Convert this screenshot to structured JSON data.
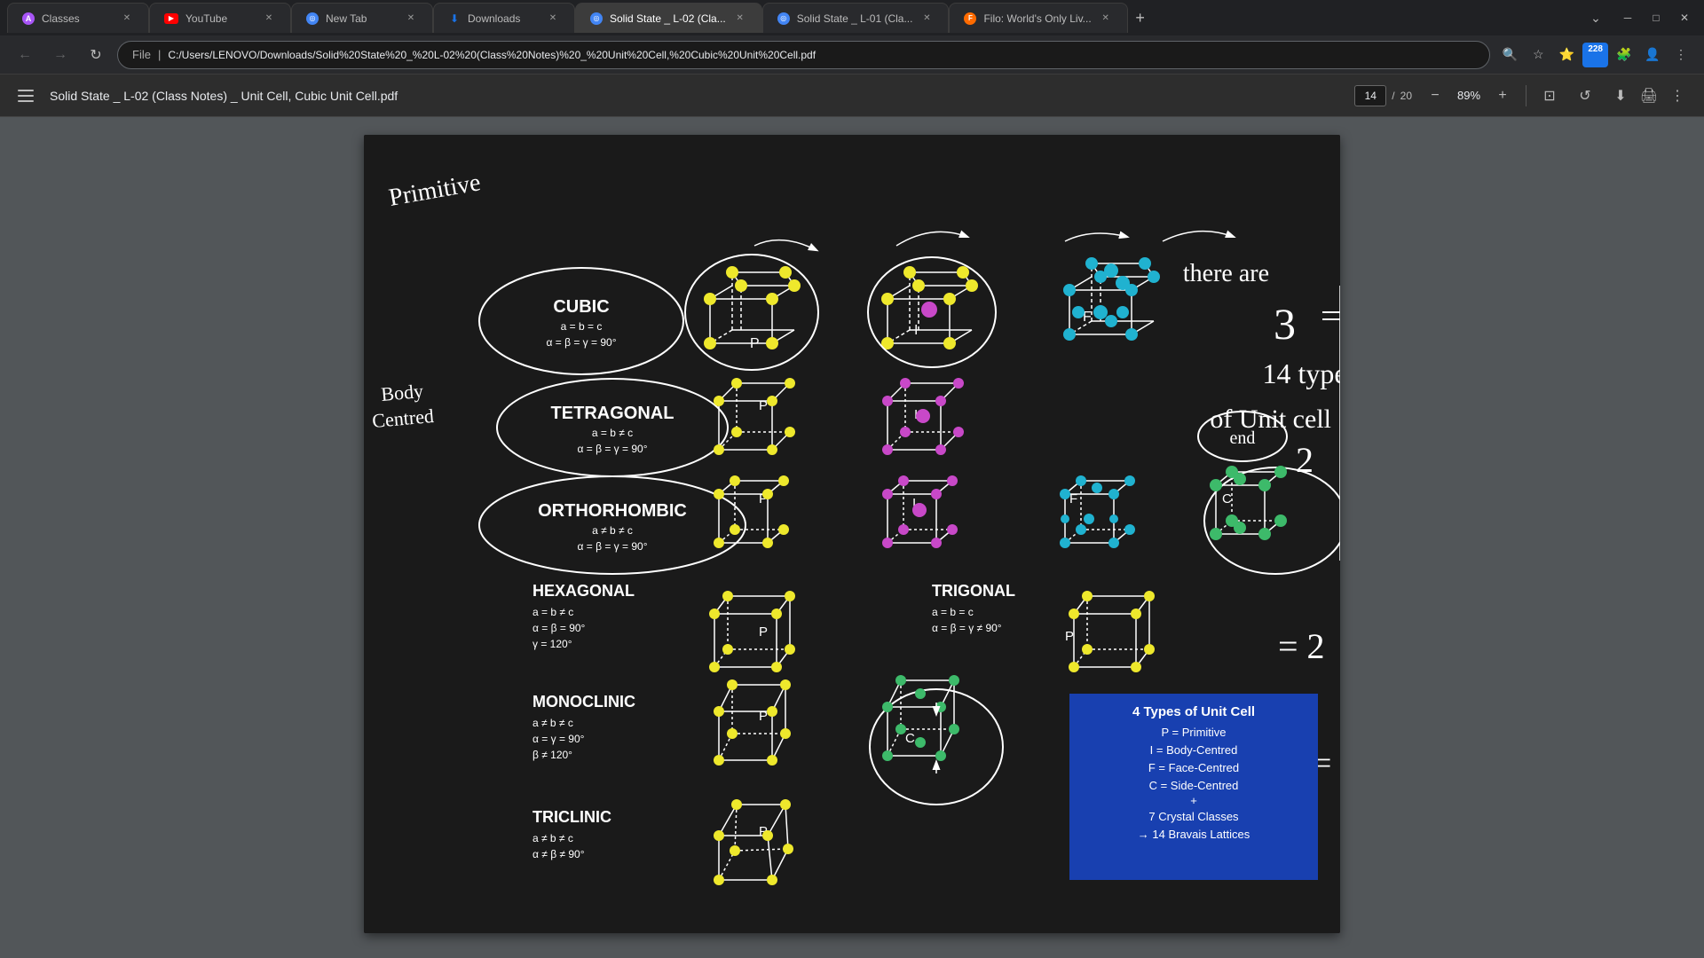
{
  "browser": {
    "tabs": [
      {
        "id": "classes",
        "label": "Classes",
        "favicon": "A",
        "active": false,
        "favicon_color": "#a855f7"
      },
      {
        "id": "youtube",
        "label": "YouTube",
        "favicon": "▶",
        "active": false,
        "favicon_color": "#ff0000"
      },
      {
        "id": "newtab",
        "label": "New Tab",
        "favicon": "◎",
        "active": false,
        "favicon_color": "#4285f4"
      },
      {
        "id": "downloads",
        "label": "Downloads",
        "favicon": "⬇",
        "active": false,
        "favicon_color": "#1a73e8"
      },
      {
        "id": "solidstate2",
        "label": "Solid State _ L-02 (Cla...",
        "favicon": "◎",
        "active": true,
        "favicon_color": "#4285f4"
      },
      {
        "id": "solidstate1",
        "label": "Solid State _ L-01 (Cla...",
        "favicon": "◎",
        "active": false,
        "favicon_color": "#4285f4"
      },
      {
        "id": "filo",
        "label": "Filo: World's Only Liv...",
        "favicon": "F",
        "active": false,
        "favicon_color": "#ff6b00"
      }
    ],
    "url": {
      "scheme": "File",
      "path": "C:/Users/LENOVO/Downloads/Solid%20State%20_%20L-02%20(Class%20Notes)%20_%20Unit%20Cell,%20Cubic%20Unit%20Cell.pdf"
    }
  },
  "pdf": {
    "title": "Solid State _ L-02 (Class Notes) _ Unit Cell, Cubic Unit Cell.pdf",
    "current_page": "14",
    "total_pages": "20",
    "zoom": "89%"
  },
  "info_box": {
    "title": "4 Types of Unit Cell",
    "lines": [
      "P = Primitive",
      "I = Body-Centred",
      "F = Face-Centred",
      "C = Side-Centred",
      "+",
      "7 Crystal Classes",
      "→ 14 Bravais Lattices"
    ]
  }
}
